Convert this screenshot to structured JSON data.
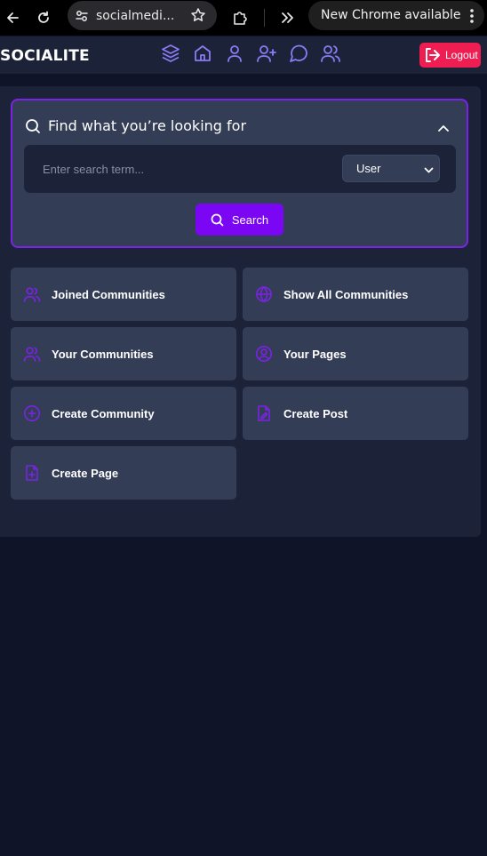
{
  "browser": {
    "url": "socialmedi...",
    "update_label": "New Chrome available"
  },
  "navbar": {
    "brand": "SOCIALITE",
    "icons": [
      "layers-icon",
      "home-icon",
      "user-icon",
      "user-plus-icon",
      "message-circle-icon",
      "users-icon"
    ],
    "logout_label": "Logout",
    "accent": "#7b22e6",
    "logout_color": "#ee1d52"
  },
  "search": {
    "title": "Find what you’re looking for",
    "placeholder": "Enter search term...",
    "type_selected": "User",
    "button_label": "Search"
  },
  "tiles": [
    {
      "label": "Joined Communities",
      "icon": "users-icon"
    },
    {
      "label": "Show All Communities",
      "icon": "globe-icon"
    },
    {
      "label": "Your Communities",
      "icon": "users-icon"
    },
    {
      "label": "Your Pages",
      "icon": "user-circle-icon"
    },
    {
      "label": "Create Community",
      "icon": "plus-circle-icon"
    },
    {
      "label": "Create Post",
      "icon": "file-edit-icon"
    },
    {
      "label": "Create Page",
      "icon": "file-plus-icon"
    }
  ]
}
